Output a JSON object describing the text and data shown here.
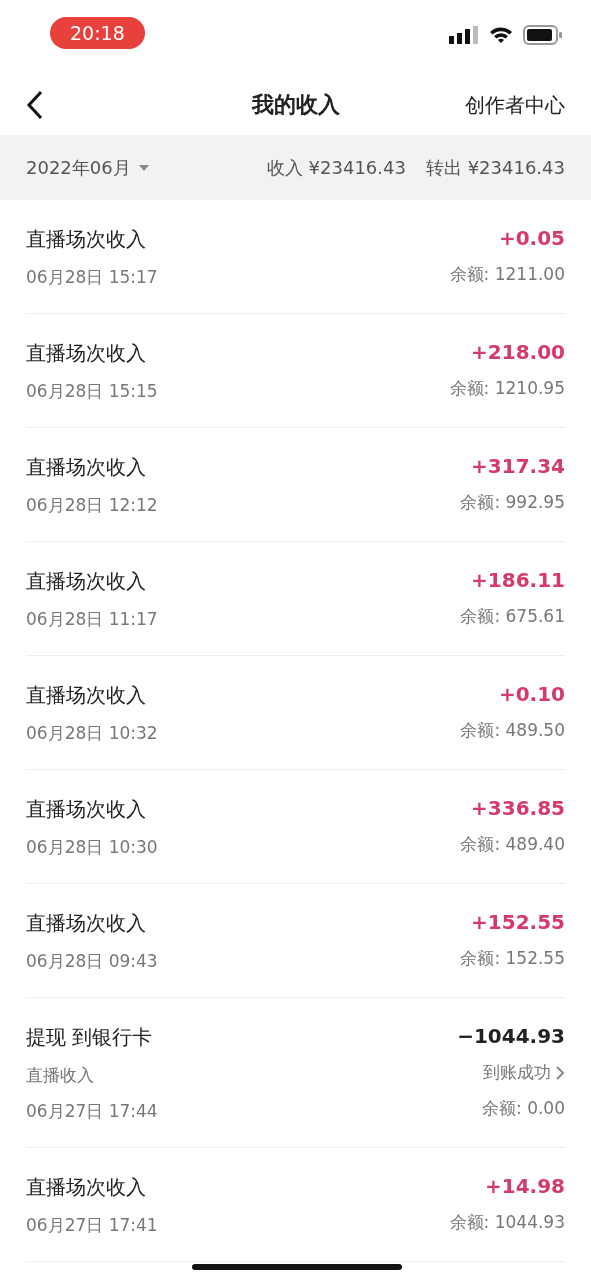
{
  "status_bar": {
    "time": "20:18"
  },
  "nav": {
    "title": "我的收入",
    "right_link": "创作者中心"
  },
  "filter": {
    "month": "2022年06月",
    "income": "收入 ¥23416.43",
    "outgo": "转出 ¥23416.43"
  },
  "rows": [
    {
      "kind": "income",
      "title": "直播场次收入",
      "date": "06月28日 15:17",
      "amount": "+0.05",
      "balance": "余额: 1211.00"
    },
    {
      "kind": "income",
      "title": "直播场次收入",
      "date": "06月28日 15:15",
      "amount": "+218.00",
      "balance": "余额: 1210.95"
    },
    {
      "kind": "income",
      "title": "直播场次收入",
      "date": "06月28日 12:12",
      "amount": "+317.34",
      "balance": "余额: 992.95"
    },
    {
      "kind": "income",
      "title": "直播场次收入",
      "date": "06月28日 11:17",
      "amount": "+186.11",
      "balance": "余额: 675.61"
    },
    {
      "kind": "income",
      "title": "直播场次收入",
      "date": "06月28日 10:32",
      "amount": "+0.10",
      "balance": "余额: 489.50"
    },
    {
      "kind": "income",
      "title": "直播场次收入",
      "date": "06月28日 10:30",
      "amount": "+336.85",
      "balance": "余额: 489.40"
    },
    {
      "kind": "income",
      "title": "直播场次收入",
      "date": "06月28日 09:43",
      "amount": "+152.55",
      "balance": "余额: 152.55"
    },
    {
      "kind": "withdrawal",
      "title": "提现 到银行卡",
      "subtitle": "直播收入",
      "date": "06月27日 17:44",
      "amount": "−1044.93",
      "status": "到账成功",
      "balance": "余额: 0.00"
    },
    {
      "kind": "income",
      "title": "直播场次收入",
      "date": "06月27日 17:41",
      "amount": "+14.98",
      "balance": "余额: 1044.93"
    }
  ]
}
